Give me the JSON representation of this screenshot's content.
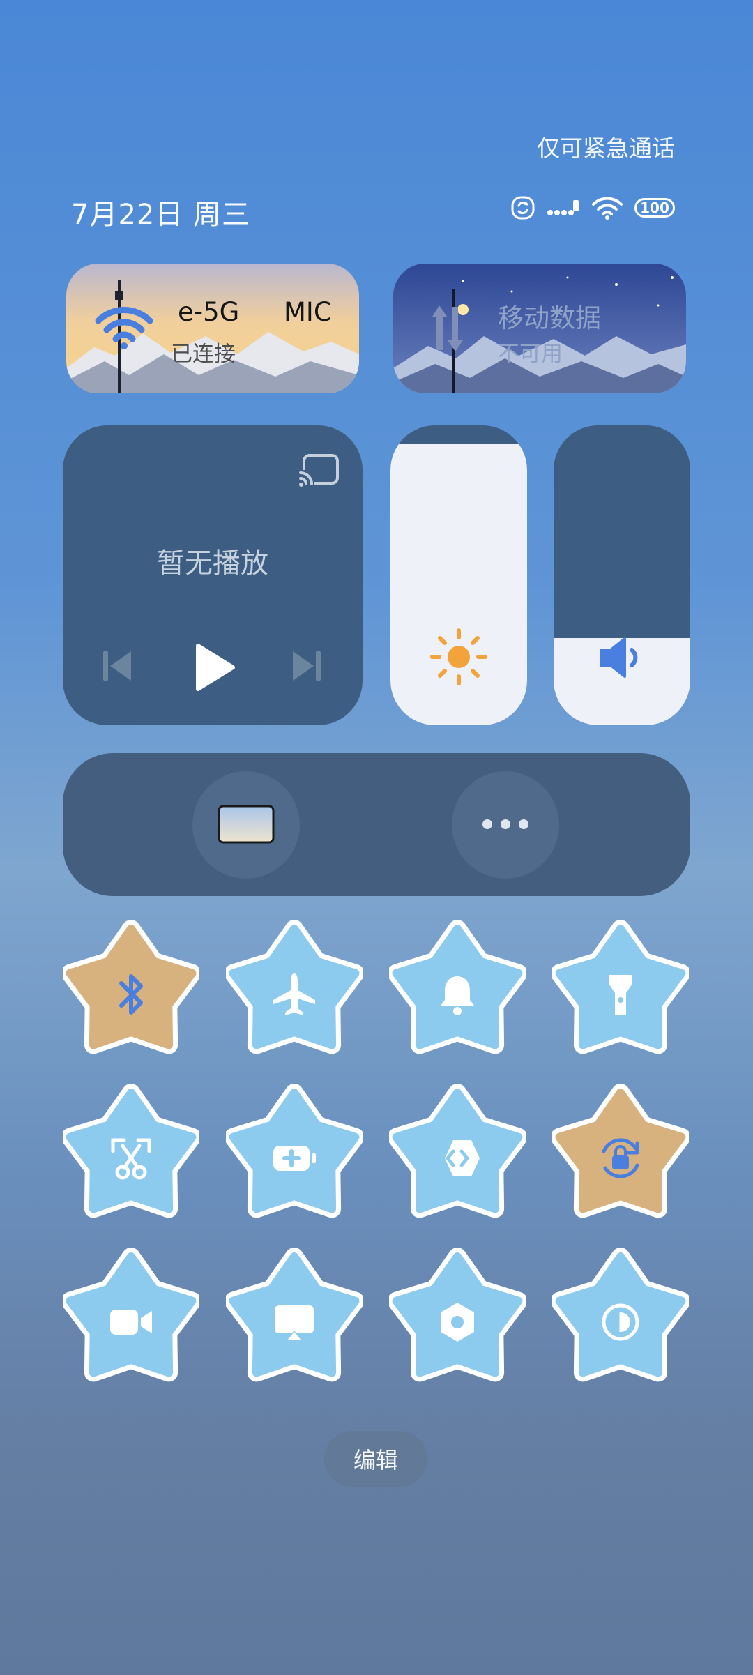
{
  "status_bar": {
    "emergency_text": "仅可紧急通话",
    "date_text": "7月22日 周三",
    "battery_level": "100"
  },
  "wifi_tile": {
    "title": "e-5G",
    "title_extra": "MIC",
    "subtitle": "已连接",
    "active": true
  },
  "data_tile": {
    "title": "移动数据",
    "subtitle": "不可用",
    "active": false
  },
  "media": {
    "status_text": "暂无播放"
  },
  "brightness": {
    "level": 0.94
  },
  "volume": {
    "level": 0.29
  },
  "toggles": [
    {
      "name": "bluetooth-toggle",
      "icon": "bluetooth-icon",
      "active": true
    },
    {
      "name": "airplane-toggle",
      "icon": "airplane-icon",
      "active": false
    },
    {
      "name": "sound-toggle",
      "icon": "bell-icon",
      "active": false
    },
    {
      "name": "flashlight-toggle",
      "icon": "flashlight-icon",
      "active": false
    },
    {
      "name": "screenshot-toggle",
      "icon": "screenshot-scissors-icon",
      "active": false
    },
    {
      "name": "battery-saver-toggle",
      "icon": "battery-saver-icon",
      "active": false
    },
    {
      "name": "nearby-share-toggle",
      "icon": "share-diamond-icon",
      "active": false
    },
    {
      "name": "rotation-lock-toggle",
      "icon": "rotation-lock-icon",
      "active": true
    },
    {
      "name": "screen-record-toggle",
      "icon": "video-camera-icon",
      "active": false
    },
    {
      "name": "cast-toggle",
      "icon": "cast-screen-icon",
      "active": false
    },
    {
      "name": "settings-toggle",
      "icon": "hexagon-settings-icon",
      "active": false
    },
    {
      "name": "dark-mode-toggle",
      "icon": "dark-mode-icon",
      "active": false
    }
  ],
  "edit_label": "编辑",
  "colors": {
    "accent_blue": "#4a7fe0",
    "star_inactive": "#8ccbee",
    "star_active": "#d8b27e",
    "sun": "#f2a33c"
  }
}
